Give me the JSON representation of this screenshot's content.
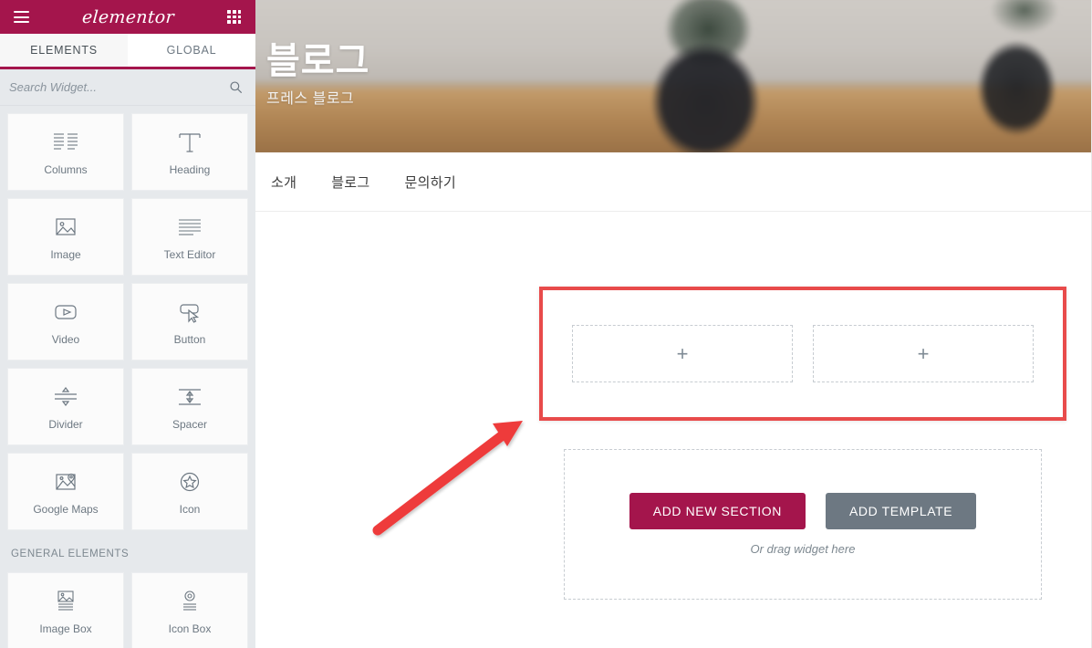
{
  "panel": {
    "header": {
      "menu_icon": "hamburger-icon",
      "logo_text": "elementor",
      "apps_icon": "grid-apps-icon"
    },
    "tabs": [
      {
        "label": "ELEMENTS",
        "active": true
      },
      {
        "label": "GLOBAL",
        "active": false
      }
    ],
    "search": {
      "placeholder": "Search Widget...",
      "value": "",
      "icon": "search-icon"
    },
    "widgets": [
      {
        "label": "Columns",
        "icon": "columns-icon"
      },
      {
        "label": "Heading",
        "icon": "heading-t-icon"
      },
      {
        "label": "Image",
        "icon": "image-icon"
      },
      {
        "label": "Text Editor",
        "icon": "text-editor-icon"
      },
      {
        "label": "Video",
        "icon": "video-play-icon"
      },
      {
        "label": "Button",
        "icon": "button-cursor-icon"
      },
      {
        "label": "Divider",
        "icon": "divider-icon"
      },
      {
        "label": "Spacer",
        "icon": "spacer-arrows-icon"
      },
      {
        "label": "Google Maps",
        "icon": "google-maps-icon"
      },
      {
        "label": "Icon",
        "icon": "star-icon"
      }
    ],
    "general_elements_label": "GENERAL ELEMENTS",
    "general_widgets": [
      {
        "label": "Image Box",
        "icon": "image-box-icon"
      },
      {
        "label": "Icon Box",
        "icon": "icon-box-icon"
      }
    ],
    "collapse_icon": "chevron-left-icon"
  },
  "canvas": {
    "hero": {
      "title": "블로그",
      "subtitle": "프레스 블로그"
    },
    "nav": [
      {
        "label": "소개"
      },
      {
        "label": "블로그"
      },
      {
        "label": "문의하기"
      }
    ],
    "selected_section": {
      "columns": [
        {
          "add_icon": "plus-icon"
        },
        {
          "add_icon": "plus-icon"
        }
      ]
    },
    "add_area": {
      "add_section_label": "ADD NEW SECTION",
      "add_template_label": "ADD TEMPLATE",
      "drag_hint": "Or drag widget here"
    },
    "annotation": {
      "arrow_icon": "red-arrow-icon"
    }
  },
  "colors": {
    "brand_maroon": "#a4154c",
    "panel_bg": "#e6e9ec",
    "text_gray": "#6d7882",
    "highlight_red": "#e84b4b",
    "template_gray": "#6d7882",
    "annotation_red": "#ee3b3b"
  }
}
